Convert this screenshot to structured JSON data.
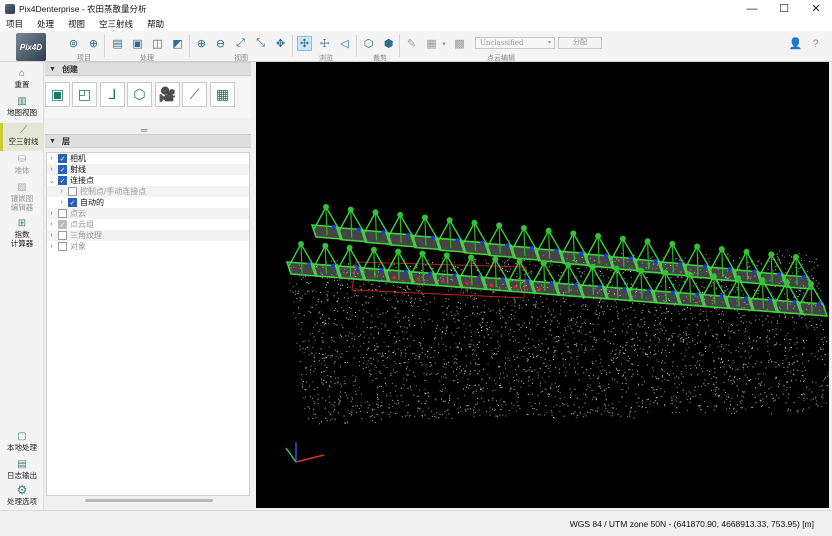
{
  "window": {
    "title": "Pix4Denterprise - 农田蒸散量分析",
    "min": "—",
    "max": "☐",
    "close": "✕"
  },
  "menu": [
    "项目",
    "处理",
    "视图",
    "空三射线",
    "帮助"
  ],
  "toolbar": {
    "logo": "Pix4D",
    "groups": [
      "项目",
      "处理",
      "视图",
      "浏览",
      "裁剪",
      "点云编辑"
    ],
    "class_select": "Unclassified",
    "assign_button": "分配"
  },
  "sidebar": [
    {
      "label": "重置",
      "icon": "home-icon"
    },
    {
      "label": "地图视图",
      "icon": "map-icon"
    },
    {
      "label": "空三射线",
      "icon": "rayfield-icon"
    },
    {
      "label": "堆体",
      "icon": "volume-icon"
    },
    {
      "label": "镶嵌图\n编辑器",
      "icon": "mosaic-icon"
    },
    {
      "label": "指数\n计算器",
      "icon": "index-calculator-icon"
    },
    {
      "label": "本地处理",
      "icon": "local-processing-icon"
    },
    {
      "label": "日志输出",
      "icon": "log-icon"
    },
    {
      "label": "处理选项",
      "icon": "gear-icon"
    }
  ],
  "panel": {
    "create_title": "创建",
    "layers_title": "层",
    "layers": [
      {
        "label": "相机",
        "checked": true,
        "indent": 0,
        "expanded": false
      },
      {
        "label": "射线",
        "checked": true,
        "indent": 0,
        "expanded": false
      },
      {
        "label": "连接点",
        "checked": true,
        "indent": 0,
        "expanded": true
      },
      {
        "label": "控制点/手动连接点",
        "checked": false,
        "indent": 1,
        "expanded": false
      },
      {
        "label": "自动的",
        "checked": true,
        "indent": 1,
        "expanded": false
      },
      {
        "label": "点云",
        "checked": false,
        "indent": 0,
        "expanded": false
      },
      {
        "label": "点云组",
        "checked": "gray",
        "indent": 0,
        "expanded": false
      },
      {
        "label": "三角纹理",
        "checked": false,
        "indent": 0,
        "expanded": false
      },
      {
        "label": "对象",
        "checked": false,
        "indent": 0,
        "expanded": false
      }
    ]
  },
  "status": {
    "coordinates": "WGS 84 / UTM zone 50N - (641870.90, 4668913.33, 753.95) [m]"
  }
}
